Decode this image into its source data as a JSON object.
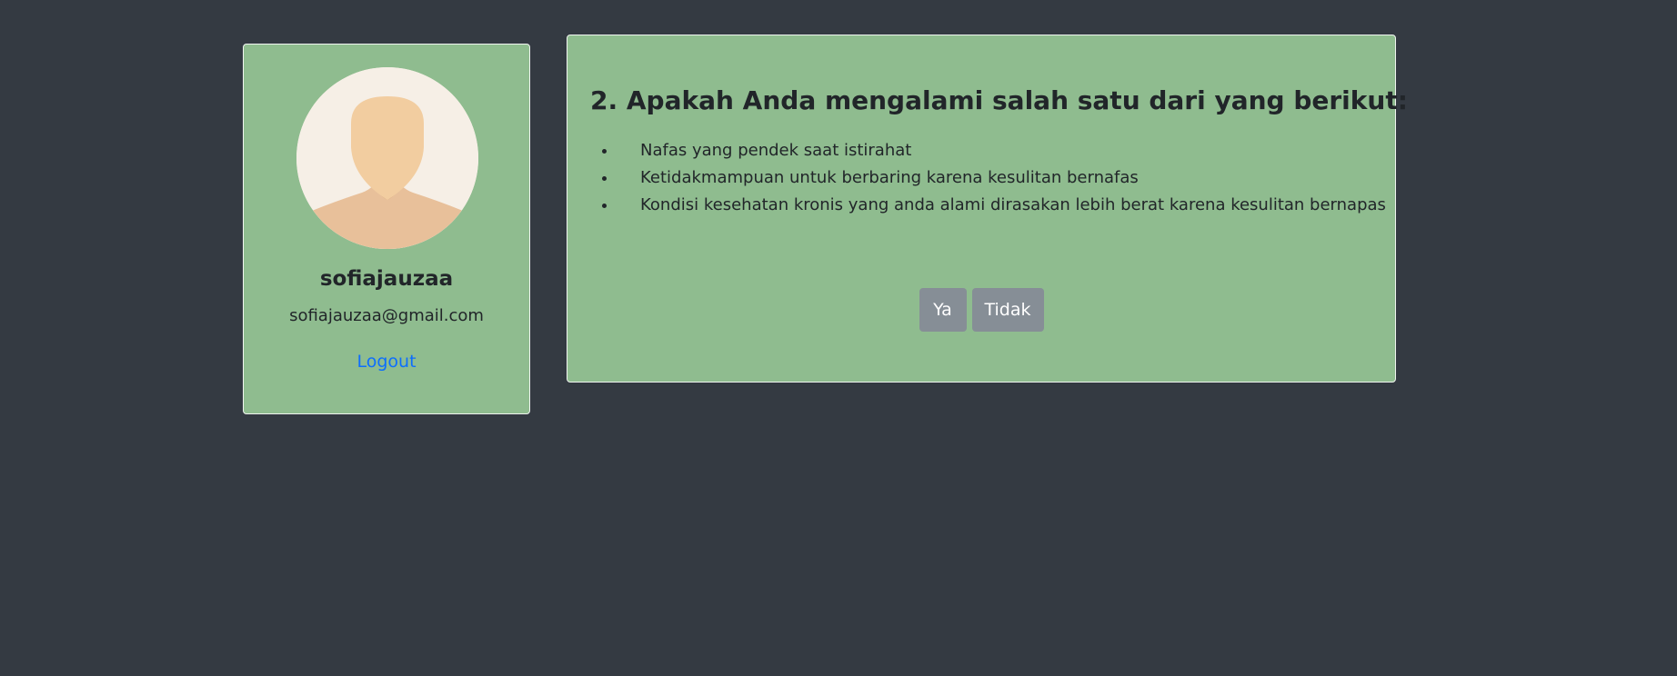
{
  "profile": {
    "avatar_icon": "user-silhouette-icon",
    "username": "sofiajauzaa",
    "email": "sofiajauzaa@gmail.com",
    "logout_label": "Logout"
  },
  "question": {
    "title": "2. Apakah Anda mengalami salah satu dari yang berikut:",
    "items": [
      "Nafas yang pendek saat istirahat",
      "Ketidakmampuan untuk berbaring karena kesulitan bernafas",
      "Kondisi kesehatan kronis yang anda alami dirasakan lebih berat karena kesulitan bernapas"
    ],
    "yes_label": "Ya",
    "no_label": "Tidak"
  },
  "colors": {
    "page_background": "#343a42",
    "card_background": "#8fbc8f",
    "button_background": "#868e96",
    "link_color": "#0d6efd"
  }
}
